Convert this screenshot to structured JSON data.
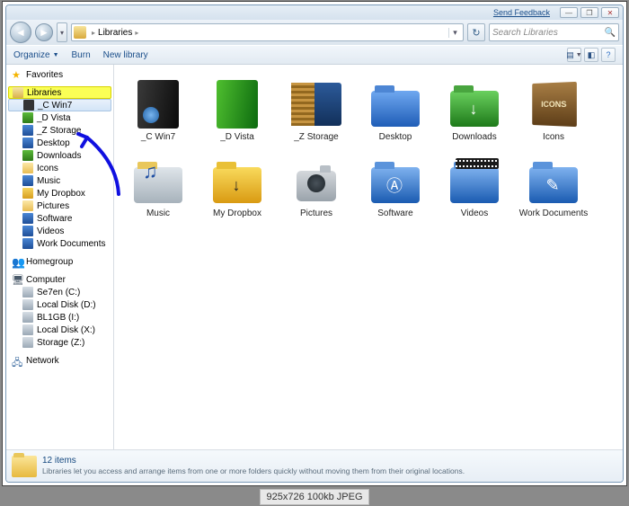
{
  "titlebar": {
    "feedback": "Send Feedback"
  },
  "nav": {
    "breadcrumb_root": "Libraries",
    "search_placeholder": "Search Libraries"
  },
  "toolbar": {
    "organize": "Organize",
    "burn": "Burn",
    "newlib": "New library"
  },
  "sidebar": {
    "favorites": "Favorites",
    "libraries": "Libraries",
    "lib_items": [
      "_C Win7",
      "_D Vista",
      "_Z Storage",
      "Desktop",
      "Downloads",
      "Icons",
      "Music",
      "My Dropbox",
      "Pictures",
      "Software",
      "Videos",
      "Work Documents"
    ],
    "homegroup": "Homegroup",
    "computer": "Computer",
    "comp_items": [
      "Se7en (C:)",
      "Local Disk (D:)",
      "BL1GB (I:)",
      "Local Disk (X:)",
      "Storage (Z:)"
    ],
    "network": "Network"
  },
  "grid": {
    "items": [
      "_C Win7",
      "_D Vista",
      "_Z Storage",
      "Desktop",
      "Downloads",
      "Icons",
      "Music",
      "My Dropbox",
      "Pictures",
      "Software",
      "Videos",
      "Work Documents"
    ]
  },
  "status": {
    "count": "12 items",
    "hint": "Libraries let you access and arrange items from one or more folders quickly without moving them from their original locations."
  },
  "caption": "925x726   100kb   JPEG"
}
